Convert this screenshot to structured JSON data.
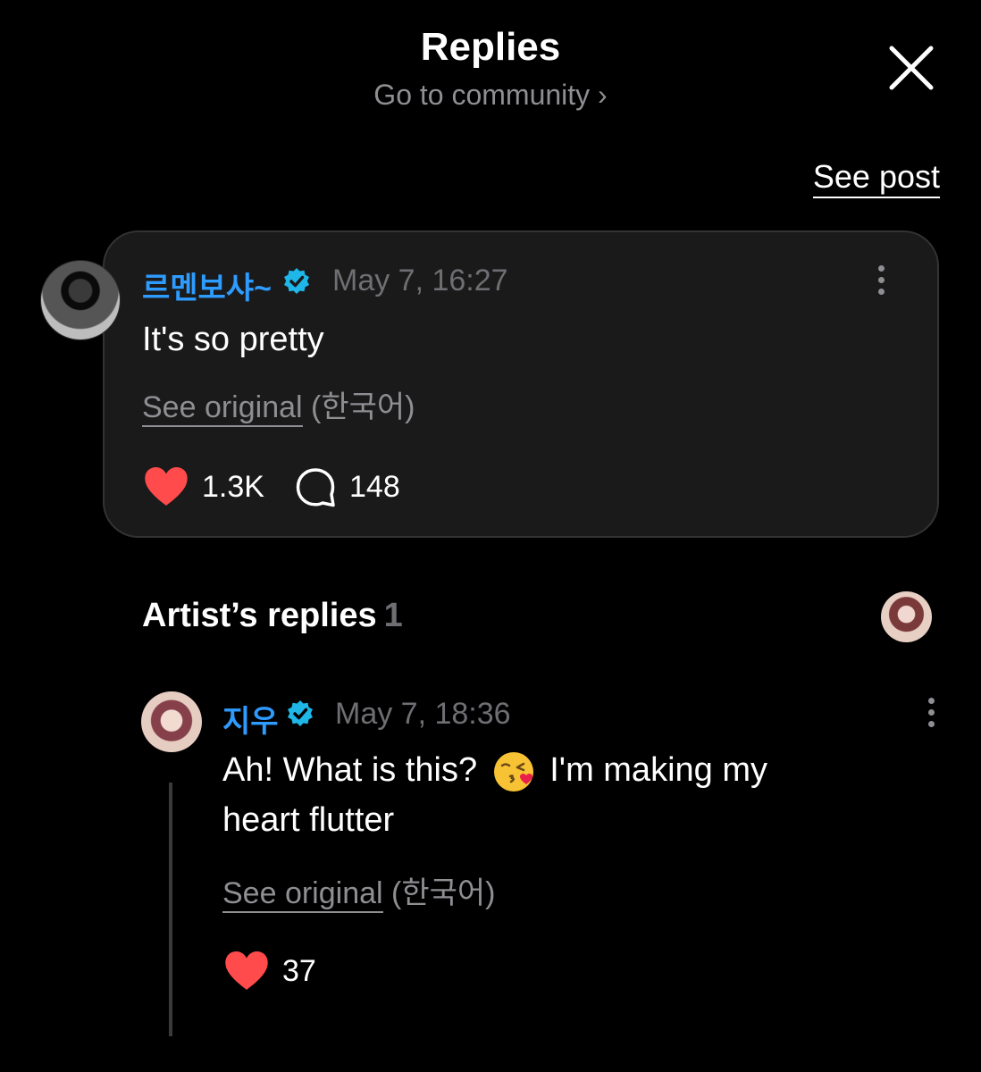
{
  "header": {
    "title": "Replies",
    "subtitle": "Go to community ›"
  },
  "actions": {
    "see_post": "See post"
  },
  "post": {
    "author": "르멘보샤~",
    "verified": true,
    "timestamp": "May 7, 16:27",
    "text": "It's so pretty",
    "see_original": "See original",
    "original_language": "(한국어)",
    "likes": "1.3K",
    "replies": "148"
  },
  "artist_replies": {
    "title": "Artist’s replies",
    "count": "1",
    "items": [
      {
        "author": "지우",
        "verified": true,
        "timestamp": "May 7, 18:36",
        "text_before_emoji": "Ah! What is this?",
        "emoji": "kissing-face-with-heart-emoji",
        "text_after_emoji": "I'm making my",
        "text_line2": "heart flutter",
        "see_original": "See original",
        "original_language": "(한국어)",
        "likes": "37"
      }
    ]
  },
  "colors": {
    "background": "#000000",
    "card": "#1a1a1a",
    "accent_blue": "#2e9bff",
    "verified_badge": "#1fb6e8",
    "heart": "#ff4b4b",
    "muted": "#8e8e93"
  }
}
